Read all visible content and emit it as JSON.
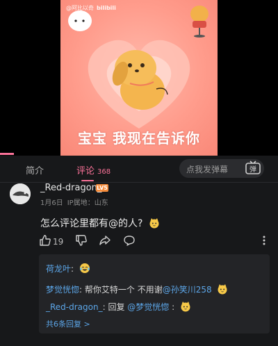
{
  "video": {
    "watermark_handle": "@阿比以奇",
    "watermark_brand": "bilibili",
    "caption": "宝宝 我现在告诉你"
  },
  "tabs": {
    "intro": "简介",
    "comments": "评论",
    "comments_count": "368",
    "danmaku_placeholder": "点我发弹幕",
    "danmaku_button": "弹"
  },
  "comment": {
    "username": "_Red-dragon_",
    "level": "LV5",
    "date": "1月6日",
    "ip": "IP属地：山东",
    "text": "怎么评论里都有@的人?",
    "likes": "19",
    "icons": [
      "thumb-up-icon",
      "thumb-down-icon",
      "share-icon",
      "comment-icon",
      "more-vertical-icon"
    ]
  },
  "replies": [
    {
      "author": "荷龙叶",
      "sep": ":",
      "text": "",
      "emoji": "laughing-cry-emoji"
    },
    {
      "author": "梦觉恍惚",
      "sep": ":",
      "text": " 帮你艾特一个 不用谢",
      "mention": "@孙笑川258",
      "emoji": "cat-emoji"
    },
    {
      "author": "_Red-dragon_",
      "sep": ":",
      "text": " 回复 ",
      "mention": "@梦觉恍惚",
      "suffix": " :",
      "emoji": "cat-emoji"
    }
  ],
  "more_replies": "共6条回复 >",
  "colors": {
    "accent": "#fb7299",
    "link": "#5ca6e8",
    "level_badge": "#f58c3c"
  }
}
